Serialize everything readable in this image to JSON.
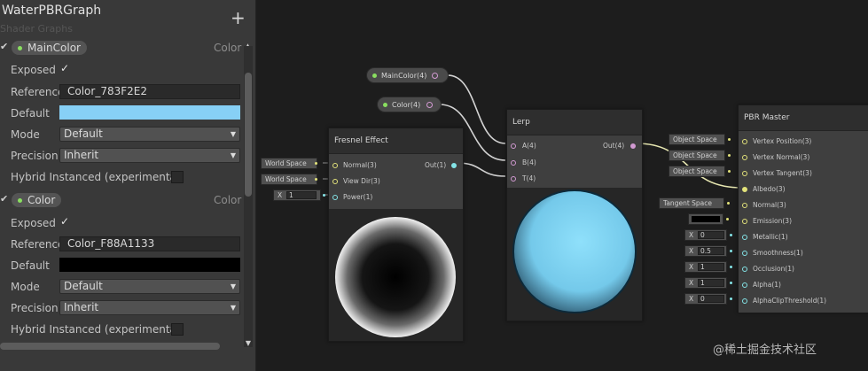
{
  "blackboard": {
    "title": "WaterPBRGraph",
    "subtitle": "Shader Graphs",
    "add_label": "+",
    "properties": [
      {
        "name": "MainColor",
        "type": "Color",
        "exposed_label": "Exposed",
        "exposed_check": "✓",
        "reference_label": "Reference",
        "reference_value": "Color_783F2E2",
        "default_label": "Default",
        "default_color": "#87d0f6",
        "mode_label": "Mode",
        "mode_value": "Default",
        "precision_label": "Precision",
        "precision_value": "Inherit",
        "hybrid_label": "Hybrid Instanced (experimental)"
      },
      {
        "name": "Color",
        "type": "Color",
        "exposed_label": "Exposed",
        "exposed_check": "✓",
        "reference_label": "Reference",
        "reference_value": "Color_F88A1133",
        "default_label": "Default",
        "default_color": "#000000",
        "mode_label": "Mode",
        "mode_value": "Default",
        "precision_label": "Precision",
        "precision_value": "Inherit",
        "hybrid_label": "Hybrid Instanced (experimental)"
      }
    ]
  },
  "graph": {
    "property_nodes": [
      {
        "label": "MainColor(4)"
      },
      {
        "label": "Color(4)"
      }
    ],
    "fresnel": {
      "title": "Fresnel Effect",
      "inputs": [
        "Normal(3)",
        "View Dir(3)",
        "Power(1)"
      ],
      "output": "Out(1)",
      "inline": [
        "World Space",
        "World Space",
        "X",
        "1"
      ]
    },
    "lerp": {
      "title": "Lerp",
      "inputs": [
        "A(4)",
        "B(4)",
        "T(4)"
      ],
      "output": "Out(4)"
    },
    "pbr_master": {
      "title": "PBR Master",
      "inputs": [
        "Vertex Position(3)",
        "Vertex Normal(3)",
        "Vertex Tangent(3)",
        "Albedo(3)",
        "Normal(3)",
        "Emission(3)",
        "Metallic(1)",
        "Smoothness(1)",
        "Occlusion(1)",
        "Alpha(1)",
        "AlphaClipThreshold(1)"
      ],
      "inline": {
        "vertex_position": "Object Space",
        "vertex_normal": "Object Space",
        "vertex_tangent": "Object Space",
        "normal": "Tangent Space",
        "metallic_axis": "X",
        "metallic": "0",
        "smoothness_axis": "X",
        "smoothness": "0.5",
        "occlusion_axis": "X",
        "occlusion": "1",
        "alpha_axis": "X",
        "alpha": "1",
        "clip_axis": "X",
        "clip": "0"
      }
    }
  },
  "colors": {
    "lerp_preview": "#7dd2f2",
    "property_dot": "#8adf60"
  },
  "watermark": "@稀土掘金技术社区"
}
